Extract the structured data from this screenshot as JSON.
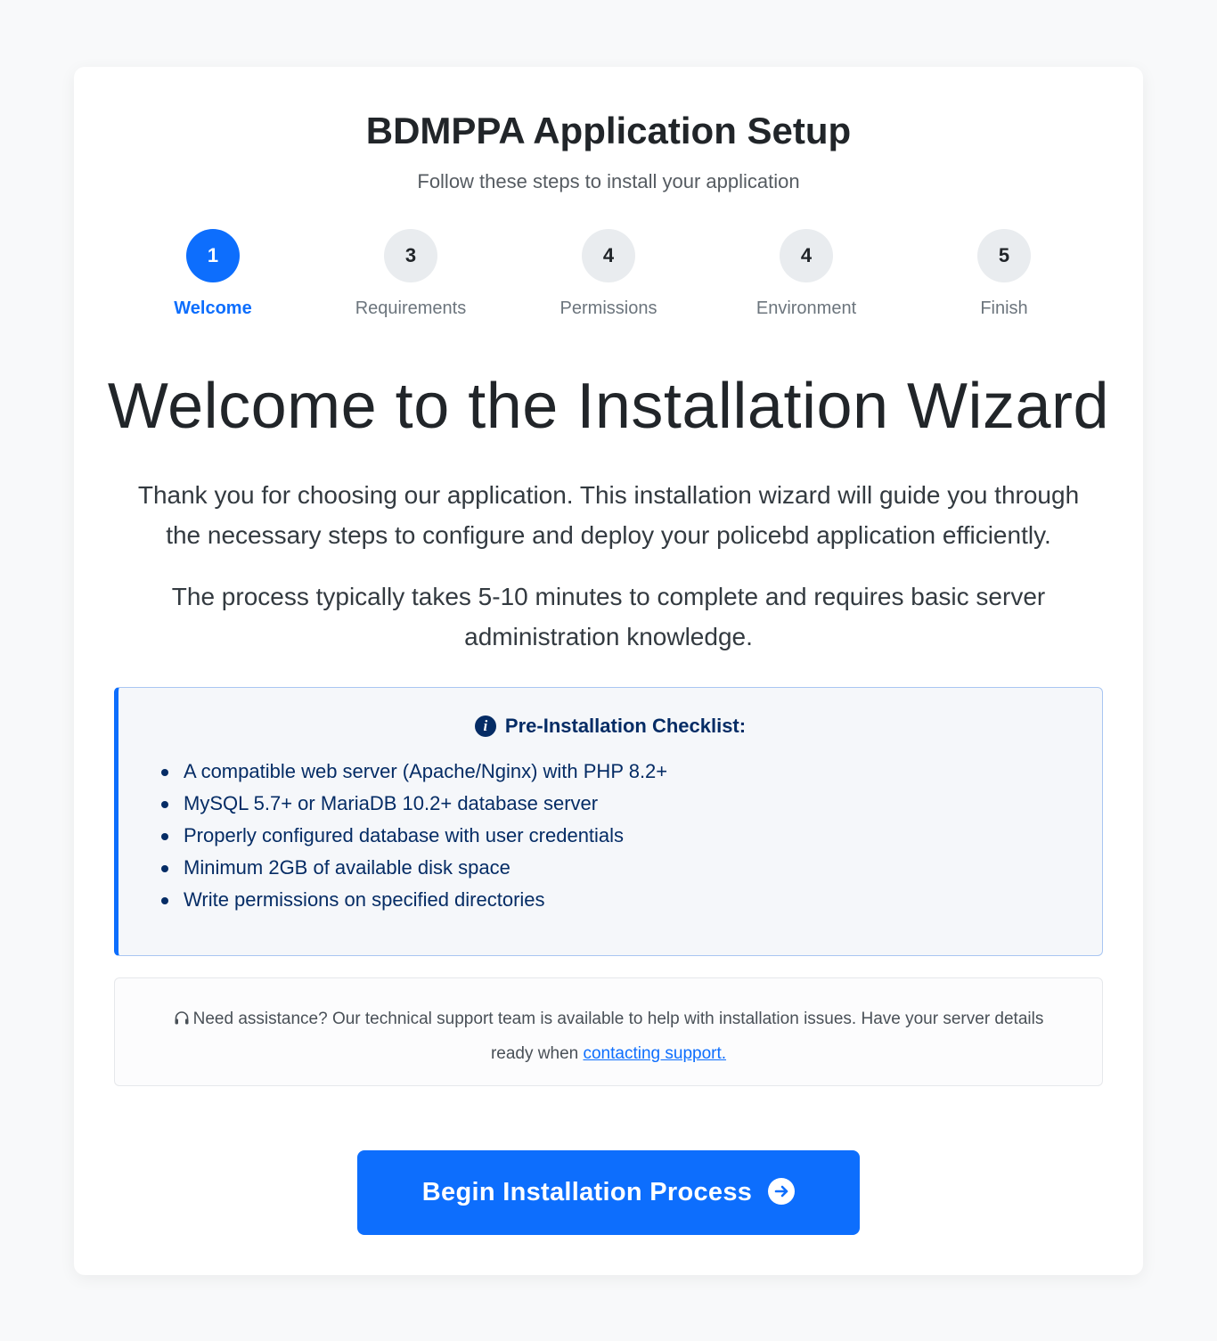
{
  "header": {
    "title": "BDMPPA Application Setup",
    "subtitle": "Follow these steps to install your application"
  },
  "steps": [
    {
      "number": "1",
      "label": "Welcome",
      "active": true
    },
    {
      "number": "3",
      "label": "Requirements",
      "active": false
    },
    {
      "number": "4",
      "label": "Permissions",
      "active": false
    },
    {
      "number": "4",
      "label": "Environment",
      "active": false
    },
    {
      "number": "5",
      "label": "Finish",
      "active": false
    }
  ],
  "main": {
    "heading": "Welcome to the Installation Wizard",
    "intro_1": "Thank you for choosing our application. This installation wizard will guide you through the necessary steps to configure and deploy your policebd application efficiently.",
    "intro_2": "The process typically takes 5-10 minutes to complete and requires basic server administration knowledge."
  },
  "checklist": {
    "icon": "info-circle-icon",
    "title": "Pre-Installation Checklist:",
    "items": [
      "A compatible web server (Apache/Nginx) with PHP 8.2+",
      "MySQL 5.7+ or MariaDB 10.2+ database server",
      "Properly configured database with user credentials",
      "Minimum 2GB of available disk space",
      "Write permissions on specified directories"
    ]
  },
  "support": {
    "icon": "headset-icon",
    "text": "Need assistance? Our technical support team is available to help with installation issues. Have your server details ready when",
    "link_text": "contacting support."
  },
  "action": {
    "button_label": "Begin Installation Process",
    "button_icon": "arrow-right-circle-icon"
  },
  "colors": {
    "primary": "#0d6efd",
    "checklist_text": "#052c65",
    "background": "#f8f9fa"
  }
}
